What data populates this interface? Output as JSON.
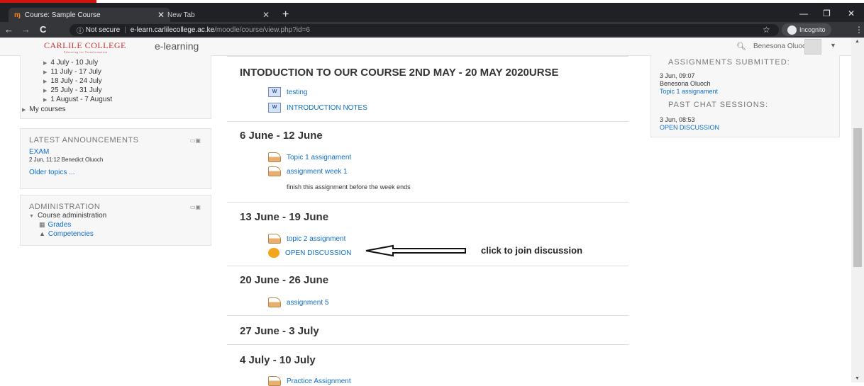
{
  "browser": {
    "tabs": [
      {
        "title": "Course: Sample Course",
        "icon": "moodle-favicon"
      },
      {
        "title": "New Tab"
      }
    ],
    "url_host": "e-learn.carlilecollege.ac.ke",
    "url_path": "/moodle/course/view.php?id=6",
    "security": "Not secure",
    "incognito_label": "Incognito"
  },
  "navbar": {
    "logo_text": "CARLILE COLLEGE",
    "logo_tagline": "Educating for Transformation",
    "brand": "e-learning",
    "user_name": "Benesona Oluoch"
  },
  "left": {
    "nav_items": [
      "4 July - 10 July",
      "11 July - 17 July",
      "18 July - 24 July",
      "25 July - 31 July",
      "1 August - 7 August"
    ],
    "my_courses": "My courses",
    "announcements": {
      "title": "LATEST ANNOUNCEMENTS",
      "item_title": "EXAM",
      "item_meta": "2 Jun, 11:12  Benedict Oluoch",
      "older": "Older topics ..."
    },
    "admin": {
      "title": "ADMINISTRATION",
      "course_admin": "Course administration",
      "grades": "Grades",
      "competencies": "Competencies"
    }
  },
  "main": {
    "sections": [
      {
        "title": "INTODUCTION TO OUR COURSE 2ND MAY - 20 MAY 2020URSE",
        "items": [
          "testing",
          "INTRODUCTION NOTES"
        ]
      },
      {
        "title": "6 June - 12 June",
        "items": [
          "Topic 1 assignament",
          "assignment week 1"
        ],
        "note": "finish this assignment before the week ends"
      },
      {
        "title": "13 June - 19 June",
        "items": [
          "topic 2 assignment",
          "OPEN DISCUSSION"
        ]
      },
      {
        "title": "20 June - 26 June",
        "items": [
          "assignment 5"
        ]
      },
      {
        "title": "27 June - 3 July",
        "items": []
      },
      {
        "title": "4 July - 10 July",
        "items": [
          "Practice Assignment"
        ]
      }
    ],
    "annotation": "click to join discussion"
  },
  "right": {
    "assignments_title": "ASSIGNMENTS SUBMITTED:",
    "a_date": "3 Jun, 09:07",
    "a_user": "Benesona Oluoch",
    "a_link": "Topic 1 assignament",
    "chat_title": "PAST CHAT SESSIONS:",
    "c_date": "3 Jun, 08:53",
    "c_link": "OPEN DISCUSSION"
  }
}
